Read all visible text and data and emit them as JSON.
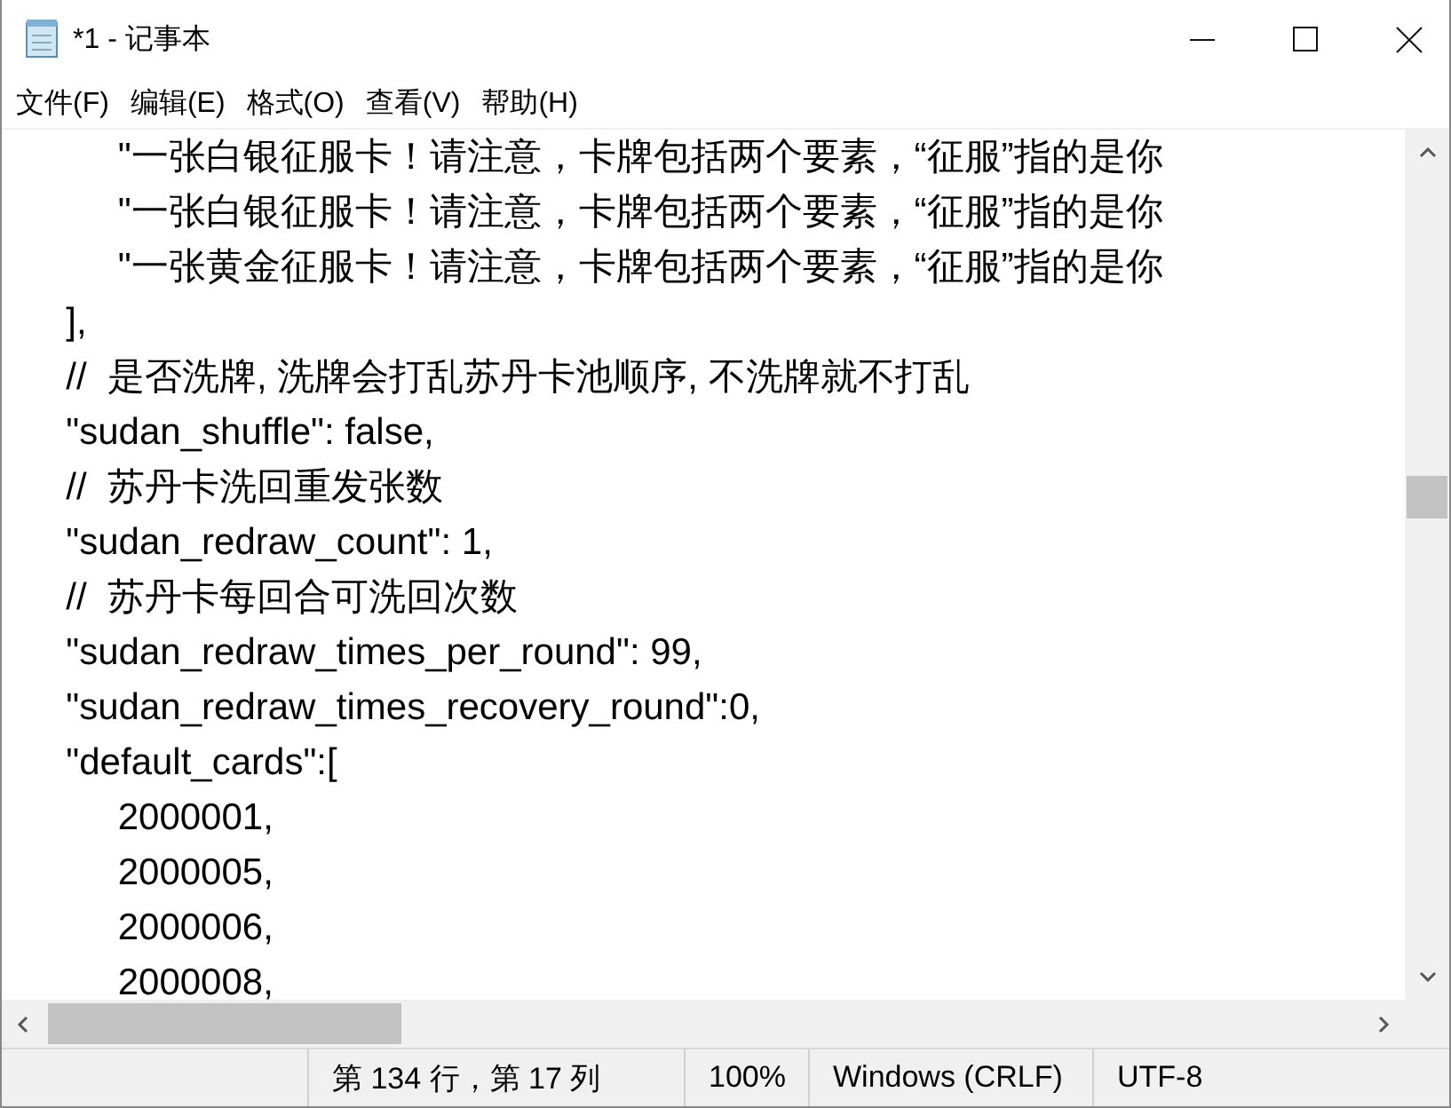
{
  "window": {
    "title": "*1 - 记事本"
  },
  "menu": [
    "文件(F)",
    "编辑(E)",
    "格式(O)",
    "查看(V)",
    "帮助(H)"
  ],
  "editor_lines": [
    "          \"一张白银征服卡！请注意，卡牌包括两个要素，“征服”指的是你",
    "          \"一张白银征服卡！请注意，卡牌包括两个要素，“征服”指的是你",
    "          \"一张黄金征服卡！请注意，卡牌包括两个要素，“征服”指的是你",
    "     ],",
    "     //  是否洗牌, 洗牌会打乱苏丹卡池顺序, 不洗牌就不打乱",
    "     \"sudan_shuffle\": false,",
    "     //  苏丹卡洗回重发张数",
    "     \"sudan_redraw_count\": 1,",
    "     //  苏丹卡每回合可洗回次数",
    "     \"sudan_redraw_times_per_round\": 99,",
    "     \"sudan_redraw_times_recovery_round\":0,",
    "     \"default_cards\":[",
    "          2000001,",
    "          2000005,",
    "          2000006,",
    "          2000008,"
  ],
  "status_bar": [
    "第 134 行，第 17 列",
    "100%",
    "Windows (CRLF)",
    "UTF-8"
  ]
}
